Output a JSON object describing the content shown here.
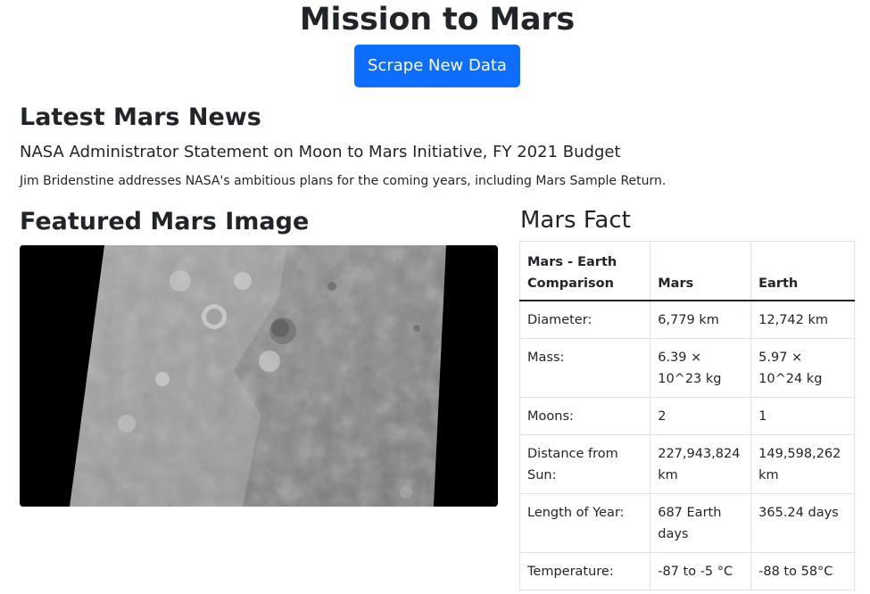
{
  "header": {
    "title": "Mission to Mars",
    "scrape_label": "Scrape New Data"
  },
  "news": {
    "heading": "Latest Mars News",
    "title": "NASA Administrator Statement on Moon to Mars Initiative, FY 2021 Budget",
    "teaser": "Jim Bridenstine addresses NASA's ambitious plans for the coming years, including Mars Sample Return."
  },
  "featured": {
    "heading": "Featured Mars Image"
  },
  "facts": {
    "heading": "Mars Fact",
    "columns": [
      "Mars - Earth Comparison",
      "Mars",
      "Earth"
    ],
    "rows": [
      [
        "Diameter:",
        "6,779 km",
        "12,742 km"
      ],
      [
        "Mass:",
        "6.39 × 10^23 kg",
        "5.97 × 10^24 kg"
      ],
      [
        "Moons:",
        "2",
        "1"
      ],
      [
        "Distance from Sun:",
        "227,943,824 km",
        "149,598,262 km"
      ],
      [
        "Length of Year:",
        "687 Earth days",
        "365.24 days"
      ],
      [
        "Temperature:",
        "-87 to -5 °C",
        "-88 to 58°C"
      ]
    ]
  },
  "colors": {
    "button_bg": "#0d6efd",
    "text": "#212529",
    "table_border": "#dee2e6"
  }
}
